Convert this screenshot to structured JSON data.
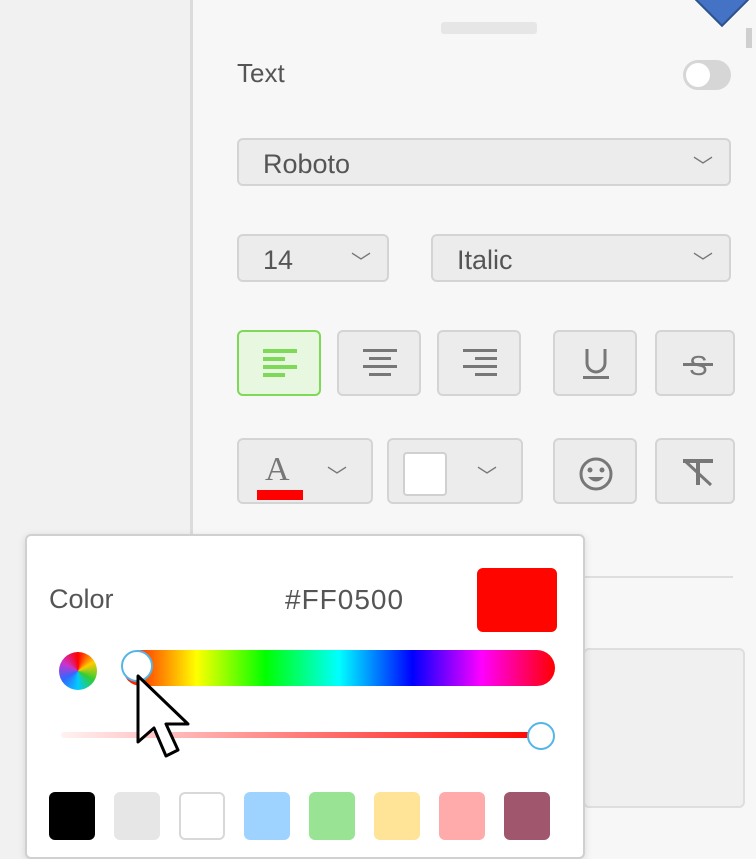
{
  "text_section": {
    "label": "Text",
    "toggle_on": false
  },
  "font": {
    "family": "Roboto",
    "size": "14",
    "style": "Italic"
  },
  "alignment": {
    "active": "left",
    "buttons": [
      "left",
      "center",
      "right"
    ]
  },
  "decorations": [
    "underline",
    "strikethrough"
  ],
  "color_picker": {
    "title": "Color",
    "hex": "#FF0500",
    "current_color": "#FF0500",
    "hue_fraction": 0.0,
    "alpha_fraction": 1.0,
    "presets": [
      "#000000",
      "#e6e6e6",
      "#ffffff",
      "#9fd3ff",
      "#98e394",
      "#ffe397",
      "#ffabab",
      "#a0566c"
    ]
  },
  "icons": {
    "text_color": "text-color-icon",
    "background_color": "background-color-icon",
    "emoji": "smiley-icon",
    "clear_format": "clear-format-icon"
  }
}
